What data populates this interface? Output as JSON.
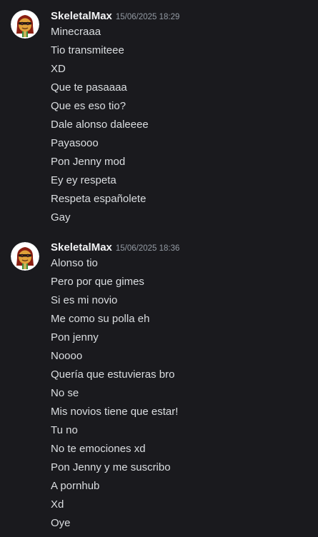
{
  "messages": [
    {
      "username": "SkeletalMax",
      "timestamp": "15/06/2025 18:29",
      "lines": [
        "Minecraaa",
        "Tio transmiteee",
        "XD",
        "Que te pasaaaa",
        "Que es eso tio?",
        "Dale alonso daleeee",
        "Payasooo",
        "Pon Jenny mod",
        "Ey ey respeta",
        "Respeta españolete",
        "Gay"
      ]
    },
    {
      "username": "SkeletalMax",
      "timestamp": "15/06/2025 18:36",
      "lines": [
        "Alonso tio",
        "Pero por que gimes",
        "Si es mi novio",
        "Me como su polla eh",
        "Pon jenny",
        "Noooo",
        "Quería que estuvieras bro",
        "No se",
        "Mis novios tiene que estar!",
        "Tu no",
        "No te emociones xd",
        "Pon Jenny y me suscribo",
        "A pornhub",
        "Xd",
        "Oye"
      ]
    }
  ],
  "colors": {
    "background": "#1a1a1e",
    "username": "#f2f3f5",
    "message_text": "#dbdee1",
    "timestamp": "#949ba4"
  },
  "icons": {
    "avatar": "avatar-icon"
  }
}
